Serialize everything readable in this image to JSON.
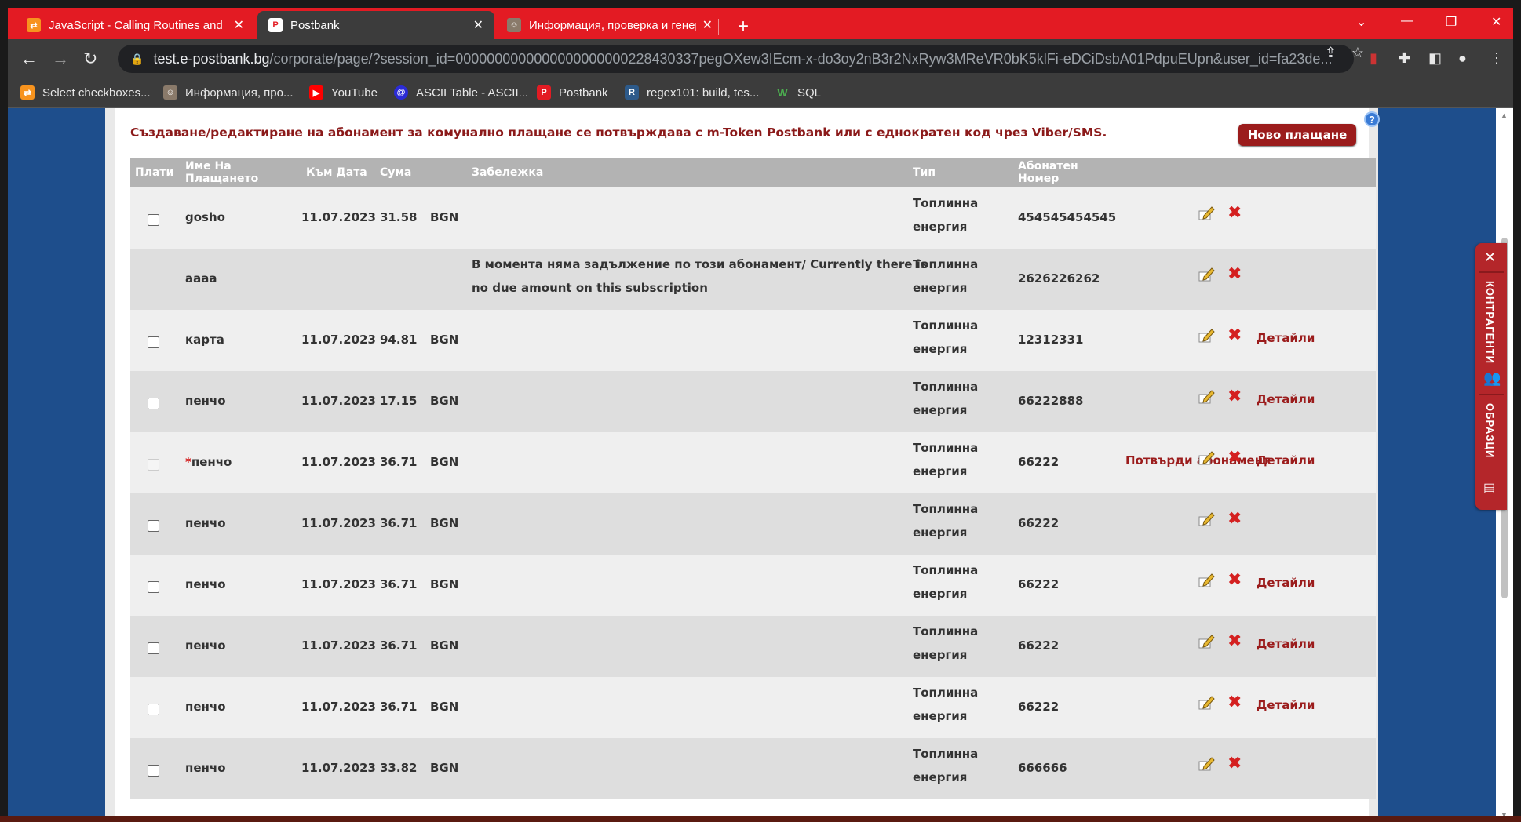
{
  "browser": {
    "tabs": [
      {
        "title": "JavaScript - Calling Routines and",
        "icon": "rest-icon",
        "active": false
      },
      {
        "title": "Postbank",
        "icon": "postbank-icon",
        "active": true
      },
      {
        "title": "Информация, проверка и генер",
        "icon": "portrait-icon",
        "active": false
      }
    ],
    "url_host": "test.e-postbank.bg",
    "url_path": "/corporate/page/?session_id=0000000000000000000000228430337pegOXew3IEcm-x-do3oy2nB3r2NxRyw3MReVR0bK5klFi-eDCiDsbA01PdpuEUpn&user_id=fa23de...",
    "bookmarks": [
      {
        "label": "Select checkboxes...",
        "icon": "rest-icon"
      },
      {
        "label": "Информация, про...",
        "icon": "portrait-icon"
      },
      {
        "label": "YouTube",
        "icon": "youtube-icon"
      },
      {
        "label": "ASCII Table - ASCII...",
        "icon": "ascii-icon"
      },
      {
        "label": "Postbank",
        "icon": "postbank-icon"
      },
      {
        "label": "regex101: build, tes...",
        "icon": "regex-icon"
      },
      {
        "label": "SQL",
        "icon": "w3-icon"
      }
    ]
  },
  "page": {
    "info_text": "Създаване/редактиране на абонамент за комунално плащане се потвърждава с m-Token Postbank или с еднократен код чрез Viber/SMS.",
    "help_label": "?",
    "new_payment_label": "Ново плащане",
    "columns": {
      "pay": "Плати",
      "name_l1": "Име На",
      "name_l2": "Плащането",
      "date": "Към Дата",
      "amount": "Сума",
      "note": "Забележка",
      "type": "Тип",
      "subno_l1": "Абонатен",
      "subno_l2": "Номер"
    },
    "rows": [
      {
        "name": "gosho",
        "date": "11.07.2023",
        "amount": "31.58",
        "currency": "BGN",
        "note1": "",
        "note2": "",
        "type1": "Топлинна",
        "type2": "енергия",
        "subno": "454545454545",
        "details": "",
        "confirm": "",
        "checkbox": "enabled",
        "pending": ""
      },
      {
        "name": "аааа",
        "date": "",
        "amount": "",
        "currency": "",
        "note1": "В момента няма задължение по този абонамент/ Currently there is",
        "note2": "no due amount on this subscription",
        "type1": "Топлинна",
        "type2": "енергия",
        "subno": "2626226262",
        "details": "",
        "confirm": "",
        "checkbox": "none",
        "pending": ""
      },
      {
        "name": "карта",
        "date": "11.07.2023",
        "amount": "94.81",
        "currency": "BGN",
        "note1": "",
        "note2": "",
        "type1": "Топлинна",
        "type2": "енергия",
        "subno": "12312331",
        "details": "Детайли",
        "confirm": "",
        "checkbox": "enabled",
        "pending": ""
      },
      {
        "name": "пенчо",
        "date": "11.07.2023",
        "amount": "17.15",
        "currency": "BGN",
        "note1": "",
        "note2": "",
        "type1": "Топлинна",
        "type2": "енергия",
        "subno": "66222888",
        "details": "Детайли",
        "confirm": "",
        "checkbox": "enabled",
        "pending": ""
      },
      {
        "name": "пенчо",
        "date": "11.07.2023",
        "amount": "36.71",
        "currency": "BGN",
        "note1": "",
        "note2": "",
        "type1": "Топлинна",
        "type2": "енергия",
        "subno": "66222",
        "details": "Детайли",
        "confirm": "Потвърди абонамент",
        "checkbox": "disabled",
        "pending": "*"
      },
      {
        "name": "пенчо",
        "date": "11.07.2023",
        "amount": "36.71",
        "currency": "BGN",
        "note1": "",
        "note2": "",
        "type1": "Топлинна",
        "type2": "енергия",
        "subno": "66222",
        "details": "",
        "confirm": "",
        "checkbox": "enabled",
        "pending": ""
      },
      {
        "name": "пенчо",
        "date": "11.07.2023",
        "amount": "36.71",
        "currency": "BGN",
        "note1": "",
        "note2": "",
        "type1": "Топлинна",
        "type2": "енергия",
        "subno": "66222",
        "details": "Детайли",
        "confirm": "",
        "checkbox": "enabled",
        "pending": ""
      },
      {
        "name": "пенчо",
        "date": "11.07.2023",
        "amount": "36.71",
        "currency": "BGN",
        "note1": "",
        "note2": "",
        "type1": "Топлинна",
        "type2": "енергия",
        "subno": "66222",
        "details": "Детайли",
        "confirm": "",
        "checkbox": "enabled",
        "pending": ""
      },
      {
        "name": "пенчо",
        "date": "11.07.2023",
        "amount": "36.71",
        "currency": "BGN",
        "note1": "",
        "note2": "",
        "type1": "Топлинна",
        "type2": "енергия",
        "subno": "66222",
        "details": "Детайли",
        "confirm": "",
        "checkbox": "enabled",
        "pending": ""
      },
      {
        "name": "пенчо",
        "date": "11.07.2023",
        "amount": "33.82",
        "currency": "BGN",
        "note1": "",
        "note2": "",
        "type1": "Топлинна",
        "type2": "енергия",
        "subno": "666666",
        "details": "",
        "confirm": "",
        "checkbox": "enabled",
        "pending": ""
      }
    ],
    "row_actions": {
      "edit_icon": "edit-icon",
      "delete_icon": "delete-icon"
    }
  },
  "side_widget": {
    "close_label": "✕",
    "counterparties_label": "КОНТРАГЕНТИ",
    "templates_label": "ОБРАЗЦИ"
  },
  "colors": {
    "tab_bar": "#e31b23",
    "accent_dark_red": "#9b1c1c",
    "page_background": "#1e4e8c",
    "header_gray": "#b3b3b3"
  }
}
